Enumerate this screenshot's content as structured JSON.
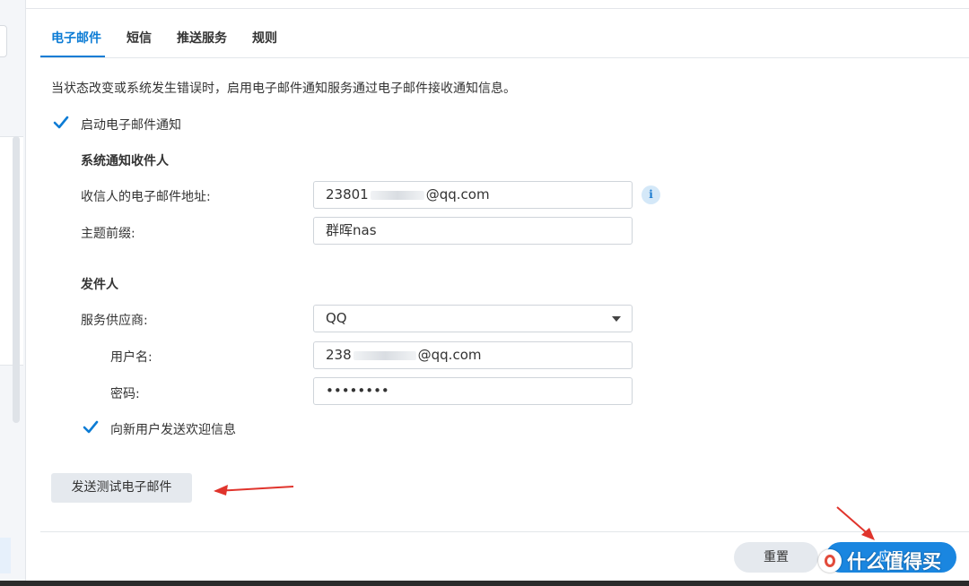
{
  "tabs": [
    "电子邮件",
    "短信",
    "推送服务",
    "规则"
  ],
  "description": "当状态改变或系统发生错误时，启用电子邮件通知服务通过电子邮件接收通知信息。",
  "enable_email": {
    "label": "启动电子邮件通知",
    "checked": true
  },
  "recipients": {
    "title": "系统通知收件人",
    "email_label": "收信人的电子邮件地址:",
    "email_value_prefix": "23801",
    "email_value_suffix": "@qq.com",
    "subject_label": "主题前缀:",
    "subject_value": "群晖nas"
  },
  "sender": {
    "title": "发件人",
    "provider_label": "服务供应商:",
    "provider_value": "QQ",
    "username_label": "用户名:",
    "username_prefix": "238",
    "username_suffix": "@qq.com",
    "password_label": "密码:",
    "password_value": "••••••••"
  },
  "welcome": {
    "label": "向新用户发送欢迎信息",
    "checked": true
  },
  "buttons": {
    "test": "发送测试电子邮件",
    "reset": "重置",
    "apply": "应用"
  },
  "watermark": "什么值得买",
  "colors": {
    "accent": "#0c7cd5",
    "apply": "#1a86e0",
    "annotation_arrow": "#e0342c"
  }
}
